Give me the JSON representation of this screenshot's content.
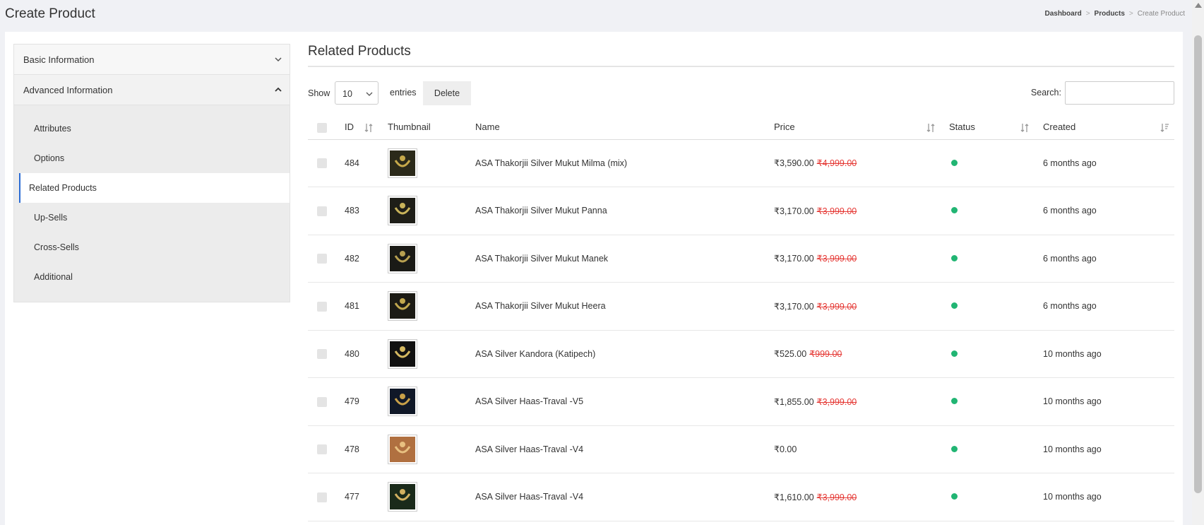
{
  "header": {
    "title": "Create Product",
    "breadcrumb": [
      "Dashboard",
      "Products",
      "Create Product"
    ],
    "separator": ">"
  },
  "sidebar": {
    "sections": [
      {
        "label": "Basic Information",
        "open": false
      },
      {
        "label": "Advanced Information",
        "open": true
      }
    ],
    "items": [
      {
        "label": "Attributes"
      },
      {
        "label": "Options"
      },
      {
        "label": "Related Products",
        "active": true
      },
      {
        "label": "Up-Sells"
      },
      {
        "label": "Cross-Sells"
      },
      {
        "label": "Additional"
      }
    ]
  },
  "main": {
    "title": "Related Products",
    "show_label": "Show",
    "entries_value": "10",
    "entries_label": "entries",
    "delete_label": "Delete",
    "search_label": "Search:",
    "search_value": "",
    "columns": [
      "ID",
      "Thumbnail",
      "Name",
      "Price",
      "Status",
      "Created"
    ],
    "rows": [
      {
        "id": "484",
        "name": "ASA Thakorjii Silver Mukut Milma (mix)",
        "price": "₹3,590.00",
        "old_price": "₹4,999.00",
        "status": "active",
        "created": "6 months ago"
      },
      {
        "id": "483",
        "name": "ASA Thakorjii Silver Mukut Panna",
        "price": "₹3,170.00",
        "old_price": "₹3,999.00",
        "status": "active",
        "created": "6 months ago"
      },
      {
        "id": "482",
        "name": "ASA Thakorjii Silver Mukut Manek",
        "price": "₹3,170.00",
        "old_price": "₹3,999.00",
        "status": "active",
        "created": "6 months ago"
      },
      {
        "id": "481",
        "name": "ASA Thakorjii Silver Mukut Heera",
        "price": "₹3,170.00",
        "old_price": "₹3,999.00",
        "status": "active",
        "created": "6 months ago"
      },
      {
        "id": "480",
        "name": "ASA Silver Kandora (Katipech)",
        "price": "₹525.00",
        "old_price": "₹999.00",
        "status": "active",
        "created": "10 months ago"
      },
      {
        "id": "479",
        "name": "ASA Silver Haas-Traval -V5",
        "price": "₹1,855.00",
        "old_price": "₹3,999.00",
        "status": "active",
        "created": "10 months ago"
      },
      {
        "id": "478",
        "name": "ASA Silver Haas-Traval -V4",
        "price": "₹0.00",
        "old_price": "",
        "status": "active",
        "created": "10 months ago"
      },
      {
        "id": "477",
        "name": "ASA Silver Haas-Traval -V4",
        "price": "₹1,610.00",
        "old_price": "₹3,999.00",
        "status": "active",
        "created": "10 months ago"
      }
    ]
  },
  "colors": {
    "accent": "#2b6cd4",
    "status_active": "#21b573",
    "old_price": "#e53935"
  }
}
